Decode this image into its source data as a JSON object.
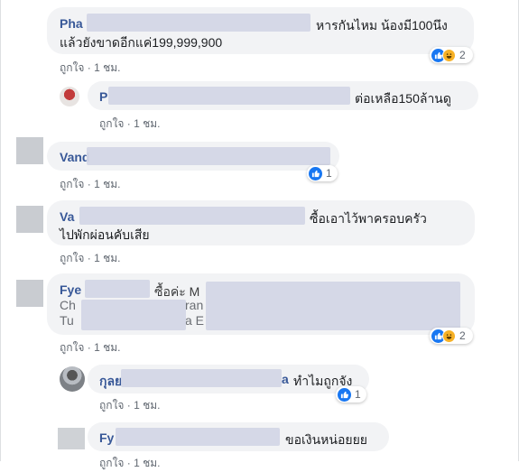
{
  "colors": {
    "name": "#385898",
    "bubble": "#f2f3f5",
    "meta": "#606770",
    "like_blue": "#1877f2",
    "haha_yellow": "#f7b125"
  },
  "comments": [
    {
      "name": "Pha",
      "text_line1": "หารกันไหม น้องมี100นึง",
      "text_line2": "แล้วยังขาดอีกแค่199,999,900",
      "like_label": "ถูกใจ",
      "time": "1 ชม.",
      "reactions": [
        "like-icon",
        "haha-icon"
      ],
      "reaction_count": "2"
    },
    {
      "name": "P",
      "text_line1": "ต่อเหลือ150ล้านดู",
      "like_label": "ถูกใจ",
      "time": "1 ชม."
    },
    {
      "name": "Vand",
      "like_label": "ถูกใจ",
      "time": "1 ชม.",
      "reactions": [
        "like-icon"
      ],
      "reaction_count": "1"
    },
    {
      "name": "Va",
      "text_line1": "ซื้อเอาไว้พาครอบครัว",
      "text_line2": "ไปพักผ่อนคับเสีย",
      "like_label": "ถูกใจ",
      "time": "1 ชม."
    },
    {
      "name": "Fye",
      "text_line1": "ซื้อค่ะ M",
      "text_line2": "Ch",
      "text_line2b": "ran",
      "text_line3": "Tu",
      "text_line3b": "a E",
      "like_label": "ถูกใจ",
      "time": "1 ชม.",
      "reactions": [
        "like-icon",
        "haha-icon"
      ],
      "reaction_count": "2"
    },
    {
      "name": "กุลย",
      "name_tail": "a",
      "text_line1": "ทำไมถูกจัง",
      "like_label": "ถูกใจ",
      "time": "1 ชม.",
      "reactions": [
        "like-icon"
      ],
      "reaction_count": "1"
    },
    {
      "name": "Fy",
      "text_line1": "ขอเงินหน่อยยย",
      "like_label": "ถูกใจ",
      "time": "1 ชม."
    }
  ],
  "meta_separator": "·"
}
